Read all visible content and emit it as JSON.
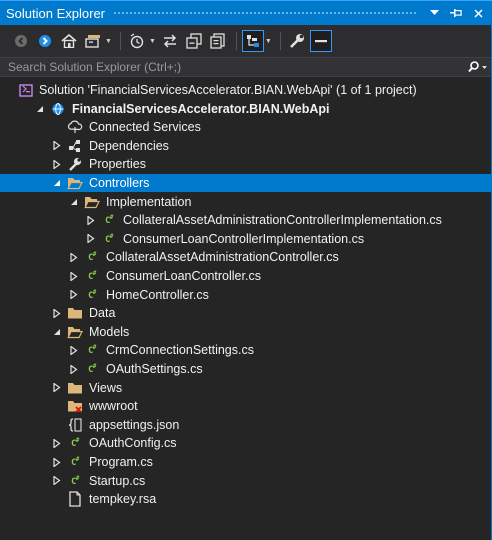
{
  "window": {
    "title": "Solution Explorer"
  },
  "search": {
    "placeholder": "Search Solution Explorer (Ctrl+;)"
  },
  "toolbar": {
    "icons": [
      "back-icon",
      "forward-icon",
      "home-icon",
      "switch-views-icon",
      "pending-changes-filter-icon",
      "sync-icon",
      "collapse-all-icon",
      "show-all-files-icon",
      "preview-icon",
      "properties-icon",
      "code-icon"
    ]
  },
  "colors": {
    "accent": "#007acc",
    "background": "#252526",
    "csharp": "#8bd24b",
    "folder": "#dcb67a"
  },
  "tree": [
    {
      "label": "Solution 'FinancialServicesAccelerator.BIAN.WebApi' (1 of 1 project)",
      "icon": "solution-icon",
      "expander": "none",
      "level": 0
    },
    {
      "label": "FinancialServicesAccelerator.BIAN.WebApi",
      "icon": "webproject-icon",
      "expander": "expanded",
      "level": 1,
      "bold": true
    },
    {
      "label": "Connected Services",
      "icon": "connected-services-icon",
      "expander": "none",
      "level": 2
    },
    {
      "label": "Dependencies",
      "icon": "dependencies-icon",
      "expander": "collapsed",
      "level": 2
    },
    {
      "label": "Properties",
      "icon": "wrench-icon",
      "expander": "collapsed",
      "level": 2
    },
    {
      "label": "Controllers",
      "icon": "folder-open-icon",
      "expander": "expanded",
      "level": 2,
      "selected": true
    },
    {
      "label": "Implementation",
      "icon": "folder-open-icon",
      "expander": "expanded",
      "level": 3
    },
    {
      "label": "CollateralAssetAdministrationControllerImplementation.cs",
      "icon": "csharp-file-icon",
      "expander": "collapsed",
      "level": 4
    },
    {
      "label": "ConsumerLoanControllerImplementation.cs",
      "icon": "csharp-file-icon",
      "expander": "collapsed",
      "level": 4
    },
    {
      "label": "CollateralAssetAdministrationController.cs",
      "icon": "csharp-file-icon",
      "expander": "collapsed",
      "level": 3
    },
    {
      "label": "ConsumerLoanController.cs",
      "icon": "csharp-file-icon",
      "expander": "collapsed",
      "level": 3
    },
    {
      "label": "HomeController.cs",
      "icon": "csharp-file-icon",
      "expander": "collapsed",
      "level": 3
    },
    {
      "label": "Data",
      "icon": "folder-icon",
      "expander": "collapsed",
      "level": 2
    },
    {
      "label": "Models",
      "icon": "folder-open-icon",
      "expander": "expanded",
      "level": 2
    },
    {
      "label": "CrmConnectionSettings.cs",
      "icon": "csharp-file-icon",
      "expander": "collapsed",
      "level": 3
    },
    {
      "label": "OAuthSettings.cs",
      "icon": "csharp-file-icon",
      "expander": "collapsed",
      "level": 3
    },
    {
      "label": "Views",
      "icon": "folder-icon",
      "expander": "collapsed",
      "level": 2
    },
    {
      "label": "wwwroot",
      "icon": "folder-missing-icon",
      "expander": "none",
      "level": 2
    },
    {
      "label": "appsettings.json",
      "icon": "json-file-icon",
      "expander": "none",
      "level": 2
    },
    {
      "label": "OAuthConfig.cs",
      "icon": "csharp-file-icon",
      "expander": "collapsed",
      "level": 2
    },
    {
      "label": "Program.cs",
      "icon": "csharp-file-icon",
      "expander": "collapsed",
      "level": 2
    },
    {
      "label": "Startup.cs",
      "icon": "csharp-file-icon",
      "expander": "collapsed",
      "level": 2
    },
    {
      "label": "tempkey.rsa",
      "icon": "file-icon",
      "expander": "none",
      "level": 2
    }
  ]
}
